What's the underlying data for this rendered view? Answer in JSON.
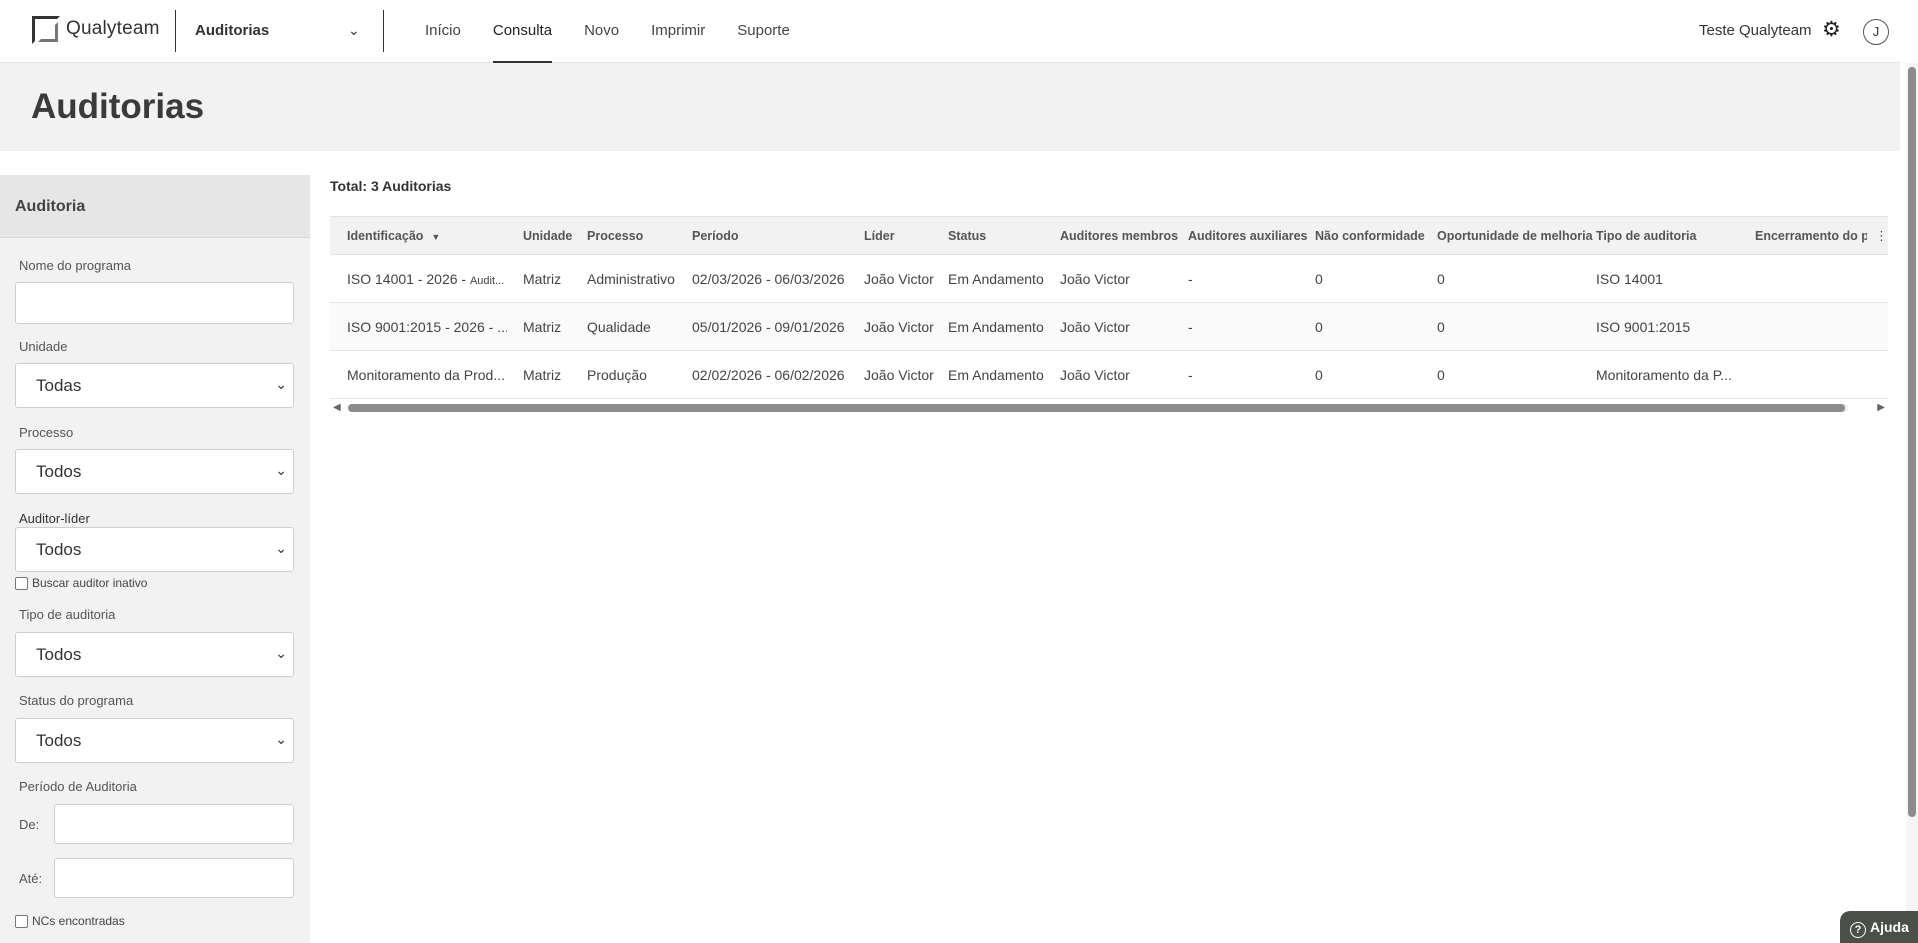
{
  "header": {
    "logo_text": "Qualyteam",
    "module": "Auditorias",
    "nav": [
      "Início",
      "Consulta",
      "Novo",
      "Imprimir",
      "Suporte"
    ],
    "active_nav": "Consulta",
    "user_name": "Teste Qualyteam",
    "avatar_initial": "J"
  },
  "page": {
    "title": "Auditorias"
  },
  "sidebar": {
    "heading": "Auditoria",
    "program_name_label": "Nome do programa",
    "unit_label": "Unidade",
    "unit_value": "Todas",
    "process_label": "Processo",
    "process_value": "Todos",
    "lead_auditor_label": "Auditor-líder",
    "lead_auditor_value": "Todos",
    "inactive_auditor_label": "Buscar auditor inativo",
    "audit_type_label": "Tipo de auditoria",
    "audit_type_value": "Todos",
    "program_status_label": "Status do programa",
    "program_status_value": "Todos",
    "period_label": "Período de Auditoria",
    "from_label": "De:",
    "to_label": "Até:",
    "ncs_found_label": "NCs encontradas"
  },
  "main": {
    "total": "Total: 3 Auditorias",
    "columns": [
      "Identificação",
      "Unidade",
      "Processo",
      "Período",
      "Líder",
      "Status",
      "Auditores membros",
      "Auditores auxiliares",
      "Não conformidade",
      "Oportunidade de melhoria",
      "Tipo de auditoria",
      "Encerramento do pr"
    ],
    "rows": [
      {
        "id_main": "ISO 14001 - 2026 - ",
        "id_sub": "Audit...",
        "unit": "Matriz",
        "process": "Administrativo",
        "period": "02/03/2026 - 06/03/2026",
        "leader": "João Victor",
        "status": "Em Andamento",
        "members": "João Victor",
        "aux": "-",
        "nc": "0",
        "om": "0",
        "type": "ISO 14001",
        "closing": ""
      },
      {
        "id_main": "ISO 9001:2015 - 2026 - ...",
        "id_sub": "",
        "unit": "Matriz",
        "process": "Qualidade",
        "period": "05/01/2026 - 09/01/2026",
        "leader": "João Victor",
        "status": "Em Andamento",
        "members": "João Victor",
        "aux": "-",
        "nc": "0",
        "om": "0",
        "type": "ISO 9001:2015",
        "closing": ""
      },
      {
        "id_main": "Monitoramento da Prod...",
        "id_sub": "",
        "unit": "Matriz",
        "process": "Produção",
        "period": "02/02/2026 - 06/02/2026",
        "leader": "João Victor",
        "status": "Em Andamento",
        "members": "João Victor",
        "aux": "-",
        "nc": "0",
        "om": "0",
        "type": "Monitoramento da P...",
        "closing": ""
      }
    ]
  },
  "help": {
    "label": "Ajuda"
  }
}
